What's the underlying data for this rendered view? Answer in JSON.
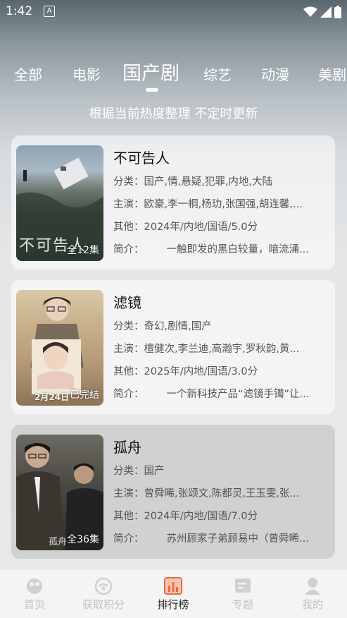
{
  "status_bar": {
    "time": "1:42",
    "notification_glyph": "A"
  },
  "tabs": [
    {
      "label": "全部",
      "active": false
    },
    {
      "label": "电影",
      "active": false
    },
    {
      "label": "国产剧",
      "active": true
    },
    {
      "label": "综艺",
      "active": false
    },
    {
      "label": "动漫",
      "active": false
    },
    {
      "label": "美剧",
      "active": false
    }
  ],
  "subtitle": "根据当前热度整理 不定时更新",
  "cards": [
    {
      "title": "不可告人",
      "badge": "全12集",
      "poster_text": "不可告人",
      "category_key": "分类：",
      "category": "国产,情,悬疑,犯罪,内地,大陆",
      "cast_key": "主演：",
      "cast": "欧豪,李一桐,杨玏,张国强,胡连馨,...",
      "other_key": "其他：",
      "other": "2024年/内地/国语/5.0分",
      "intro_key": "简介：",
      "intro": "一触即发的黑白较量，暗流涌..."
    },
    {
      "title": "滤镜",
      "badge": "已完结",
      "poster_text": "2月24日",
      "category_key": "分类：",
      "category": "奇幻,剧情,国产",
      "cast_key": "主演：",
      "cast": "檀健次,李兰迪,高瀚宇,罗秋韵,黄...",
      "other_key": "其他：",
      "other": "2025年/内地/国语/3.0分",
      "intro_key": "简介：",
      "intro": "一个新科技产品“滤镜手镯”让..."
    },
    {
      "title": "孤舟",
      "badge": "全36集",
      "poster_text": "孤舟",
      "category_key": "分类：",
      "category": "国产",
      "cast_key": "主演：",
      "cast": "曾舜晞,张颂文,陈都灵,王玉雯,张...",
      "other_key": "其他：",
      "other": "2024年/内地/国语/7.0分",
      "intro_key": "简介：",
      "intro": "苏州顾家子弟顾易中（曾舜晞..."
    }
  ],
  "bottom_nav": [
    {
      "label": "首页",
      "icon": "home-icon",
      "active": false
    },
    {
      "label": "获取积分",
      "icon": "points-icon",
      "active": false
    },
    {
      "label": "排行榜",
      "icon": "ranking-icon",
      "active": true
    },
    {
      "label": "专题",
      "icon": "topic-icon",
      "active": false
    },
    {
      "label": "我的",
      "icon": "profile-icon",
      "active": false
    }
  ],
  "colors": {
    "accent": "#f06a3a",
    "active_text": "#222222",
    "inactive_text": "#c2c2c2"
  }
}
